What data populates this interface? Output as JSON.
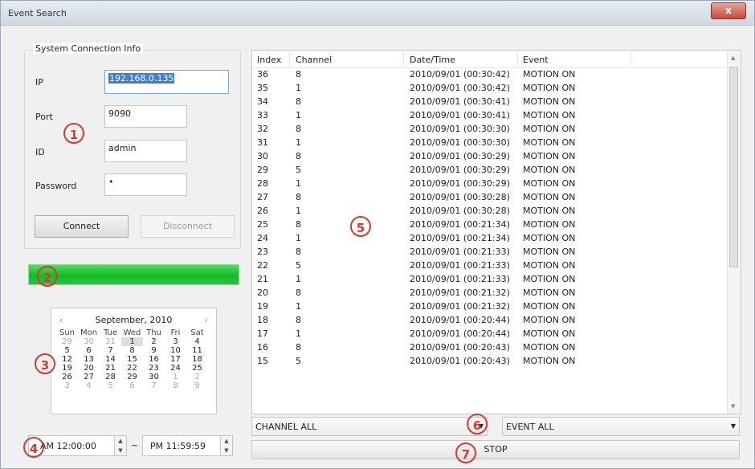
{
  "window": {
    "title": "Event Search",
    "close_label": "x"
  },
  "connection": {
    "group_title": "System Connection Info",
    "ip_label": "IP",
    "ip_value": "192.168.0.135",
    "port_label": "Port",
    "port_value": "9090",
    "id_label": "ID",
    "id_value": "admin",
    "password_label": "Password",
    "password_value": "•",
    "connect_label": "Connect",
    "disconnect_label": "Disconnect"
  },
  "progress": {
    "value_percent": 100,
    "fill_color": "#1dbf35"
  },
  "calendar": {
    "month_label": "September, 2010",
    "prev": "‹",
    "next": "›",
    "weekdays": [
      "Sun",
      "Mon",
      "Tue",
      "Wed",
      "Thu",
      "Fri",
      "Sat"
    ],
    "weeks": [
      [
        "29",
        "30",
        "31",
        "1",
        "2",
        "3",
        "4"
      ],
      [
        "5",
        "6",
        "7",
        "8",
        "9",
        "10",
        "11"
      ],
      [
        "12",
        "13",
        "14",
        "15",
        "16",
        "17",
        "18"
      ],
      [
        "19",
        "20",
        "21",
        "22",
        "23",
        "24",
        "25"
      ],
      [
        "26",
        "27",
        "28",
        "29",
        "30",
        "1",
        "2"
      ],
      [
        "3",
        "4",
        "5",
        "6",
        "7",
        "8",
        "9"
      ]
    ],
    "today": "1"
  },
  "time_range": {
    "start": "AM 12:00:00",
    "separator": "~",
    "end": "PM 11:59:59"
  },
  "event_list": {
    "columns": [
      "Index",
      "Channel",
      "Date/Time",
      "Event"
    ],
    "rows": [
      [
        "36",
        "8",
        "2010/09/01 (00:30:42)",
        "MOTION ON"
      ],
      [
        "35",
        "1",
        "2010/09/01 (00:30:42)",
        "MOTION ON"
      ],
      [
        "34",
        "8",
        "2010/09/01 (00:30:41)",
        "MOTION ON"
      ],
      [
        "33",
        "1",
        "2010/09/01 (00:30:41)",
        "MOTION ON"
      ],
      [
        "32",
        "8",
        "2010/09/01 (00:30:30)",
        "MOTION ON"
      ],
      [
        "31",
        "1",
        "2010/09/01 (00:30:30)",
        "MOTION ON"
      ],
      [
        "30",
        "8",
        "2010/09/01 (00:30:29)",
        "MOTION ON"
      ],
      [
        "29",
        "5",
        "2010/09/01 (00:30:29)",
        "MOTION ON"
      ],
      [
        "28",
        "1",
        "2010/09/01 (00:30:29)",
        "MOTION ON"
      ],
      [
        "27",
        "8",
        "2010/09/01 (00:30:28)",
        "MOTION ON"
      ],
      [
        "26",
        "1",
        "2010/09/01 (00:30:28)",
        "MOTION ON"
      ],
      [
        "25",
        "8",
        "2010/09/01 (00:21:34)",
        "MOTION ON"
      ],
      [
        "24",
        "1",
        "2010/09/01 (00:21:34)",
        "MOTION ON"
      ],
      [
        "23",
        "8",
        "2010/09/01 (00:21:33)",
        "MOTION ON"
      ],
      [
        "22",
        "5",
        "2010/09/01 (00:21:33)",
        "MOTION ON"
      ],
      [
        "21",
        "1",
        "2010/09/01 (00:21:33)",
        "MOTION ON"
      ],
      [
        "20",
        "8",
        "2010/09/01 (00:21:32)",
        "MOTION ON"
      ],
      [
        "19",
        "1",
        "2010/09/01 (00:21:32)",
        "MOTION ON"
      ],
      [
        "18",
        "8",
        "2010/09/01 (00:20:44)",
        "MOTION ON"
      ],
      [
        "17",
        "1",
        "2010/09/01 (00:20:44)",
        "MOTION ON"
      ],
      [
        "16",
        "8",
        "2010/09/01 (00:20:43)",
        "MOTION ON"
      ],
      [
        "15",
        "5",
        "2010/09/01 (00:20:43)",
        "MOTION ON"
      ]
    ]
  },
  "filters": {
    "channel_value": "CHANNEL ALL",
    "event_value": "EVENT ALL"
  },
  "stop_label": "STOP",
  "markers": [
    "1",
    "2",
    "3",
    "4",
    "5",
    "6",
    "7"
  ]
}
